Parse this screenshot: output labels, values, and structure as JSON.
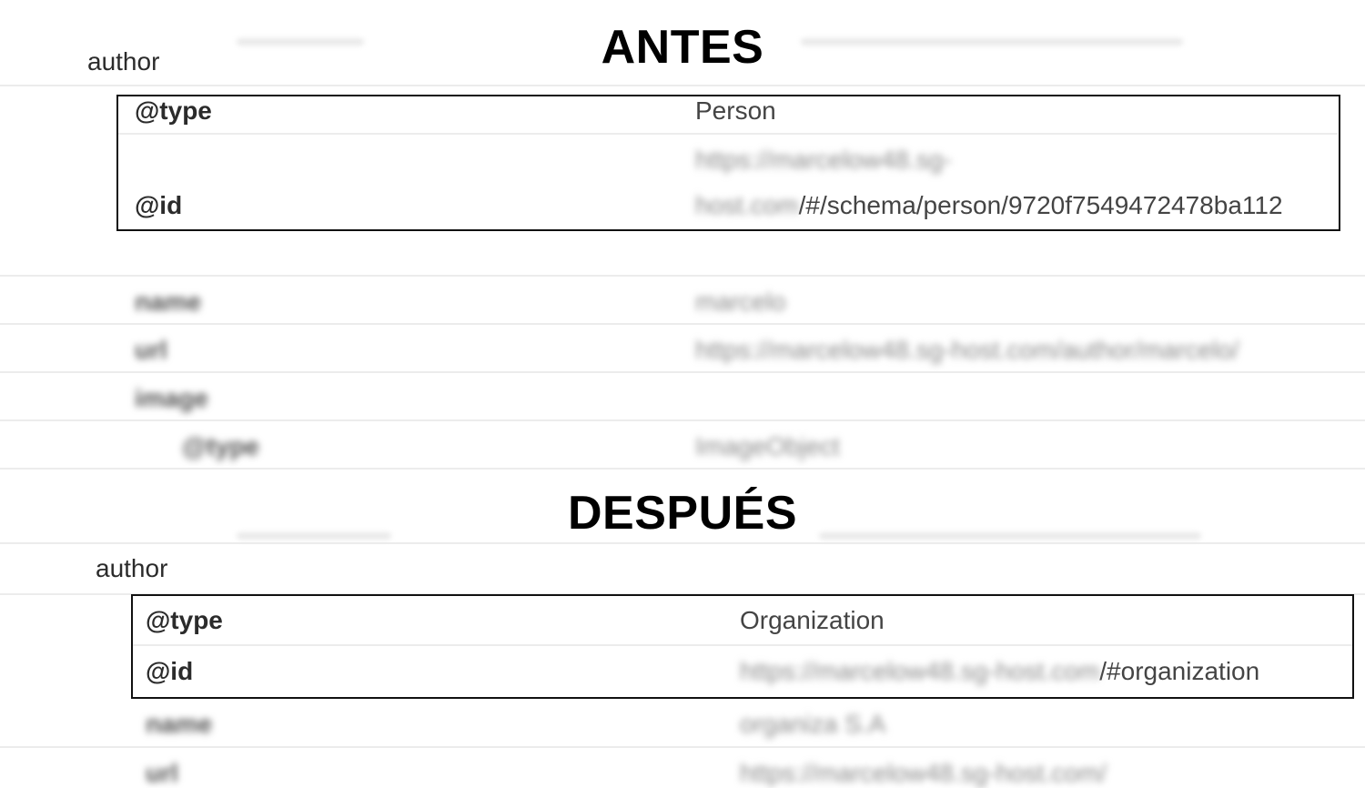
{
  "before": {
    "heading": "ANTES",
    "author_label": "author",
    "rows": [
      {
        "key": "@type",
        "value": "Person"
      },
      {
        "key": "@id",
        "value_line1": "https://marcelow48.sg-",
        "value_line2_blur": "host.com",
        "value_line2": "/#/schema/person/9720f7549472478ba112"
      }
    ],
    "blurred_rows": [
      {
        "key": "name",
        "value": "marcelo"
      },
      {
        "key": "url",
        "value": "https://marcelow48.sg-host.com/author/marcelo/"
      },
      {
        "key": "image",
        "value": ""
      },
      {
        "key": "@type",
        "value": "ImageObject"
      }
    ]
  },
  "after": {
    "heading": "DESPUÉS",
    "author_label": "author",
    "rows": [
      {
        "key": "@type",
        "value": "Organization"
      },
      {
        "key": "@id",
        "value_blur": "https://marcelow48.sg-host.com",
        "value": "/#organization"
      }
    ],
    "blurred_rows": [
      {
        "key": "name",
        "value": "organiza S.A"
      },
      {
        "key": "url",
        "value": "https://marcelow48.sg-host.com/"
      }
    ]
  }
}
